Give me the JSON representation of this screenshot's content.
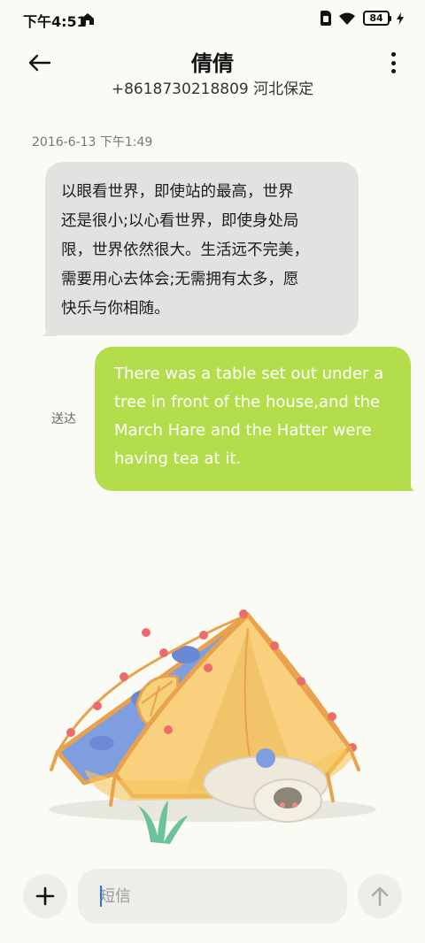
{
  "status_bar": {
    "time": "下午4:51",
    "battery": "84",
    "icons": [
      "home-icon",
      "sim-icon",
      "wifi-icon",
      "battery-icon",
      "charging-icon"
    ]
  },
  "header": {
    "contact_name": "倩倩",
    "contact_number": "+8618730218809 河北保定",
    "back_icon": "arrow-left-icon",
    "more_icon": "more-vertical-icon"
  },
  "conversation": {
    "timestamp": "2016-6-13 下午1:49",
    "messages": [
      {
        "direction": "incoming",
        "lines": [
          "以眼看世界，即使站的最高，世界",
          "还是很小;以心看世界，即使身处局",
          "限，世界依然很大。生活远不完美，",
          "需要用心去体会;无需拥有太多，愿",
          "快乐与你相随。"
        ],
        "color": "#e2e2e0"
      },
      {
        "direction": "outgoing",
        "lines": [
          "There was a table set out under a",
          "tree in front of the house,and the",
          "March Hare and the Hatter were",
          "having tea at it."
        ],
        "status": "送达",
        "color": "#b4dd4c"
      }
    ]
  },
  "composer": {
    "placeholder": "短信",
    "value": "",
    "add_icon": "plus-icon",
    "send_icon": "arrow-up-icon"
  },
  "colors": {
    "background": "#fbfbf6",
    "outgoing_bubble": "#b4dd4c",
    "incoming_bubble": "#e2e2e0",
    "accent_caret": "#2f6fe4"
  }
}
